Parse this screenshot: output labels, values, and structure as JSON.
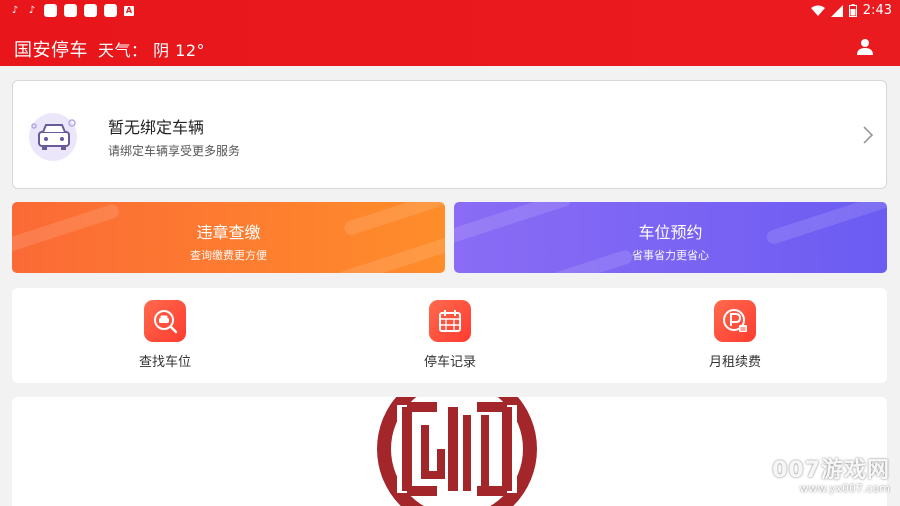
{
  "status_bar": {
    "time": "2:43",
    "notif_letter": "A"
  },
  "header": {
    "title": "国安停车",
    "weather": "天气： 阴 12°"
  },
  "vehicle": {
    "title": "暂无绑定车辆",
    "subtitle": "请绑定车辆享受更多服务"
  },
  "banners": [
    {
      "title": "违章查缴",
      "subtitle": "查询缴费更方便"
    },
    {
      "title": "车位预约",
      "subtitle": "省事省力更省心"
    }
  ],
  "quick_actions": [
    {
      "label": "查找车位",
      "icon": "search-parking-icon"
    },
    {
      "label": "停车记录",
      "icon": "calendar-record-icon"
    },
    {
      "label": "月租续费",
      "icon": "parking-fee-icon"
    }
  ],
  "watermark": {
    "main": "007游戏网",
    "url": "www.yx007.com"
  },
  "colors": {
    "brand_red": "#e8161a",
    "orange_banner": "#fb6a36",
    "purple_banner": "#7a64f3",
    "icon_red": "#ff4a3a",
    "logo_red": "#a3262a"
  }
}
